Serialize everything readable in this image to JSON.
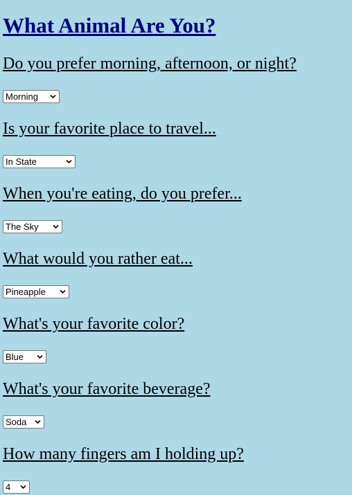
{
  "page": {
    "title": "What Animal Are You?"
  },
  "questions": [
    {
      "text": "Do you prefer morning, afternoon, or night?",
      "selected": "Morning"
    },
    {
      "text": "Is your favorite place to travel...",
      "selected": "In State"
    },
    {
      "text": "When you're eating, do you prefer...",
      "selected": "The Sky"
    },
    {
      "text": "What would you rather eat...",
      "selected": "Pineapple"
    },
    {
      "text": "What's your favorite color?",
      "selected": "Blue"
    },
    {
      "text": "What's your favorite beverage?",
      "selected": "Soda"
    },
    {
      "text": "How many fingers am I holding up?",
      "selected": "4"
    }
  ],
  "icons": {
    "dropdown": "chevron-down-icon"
  },
  "colors": {
    "background": "#add8e6",
    "title": "#000080"
  }
}
